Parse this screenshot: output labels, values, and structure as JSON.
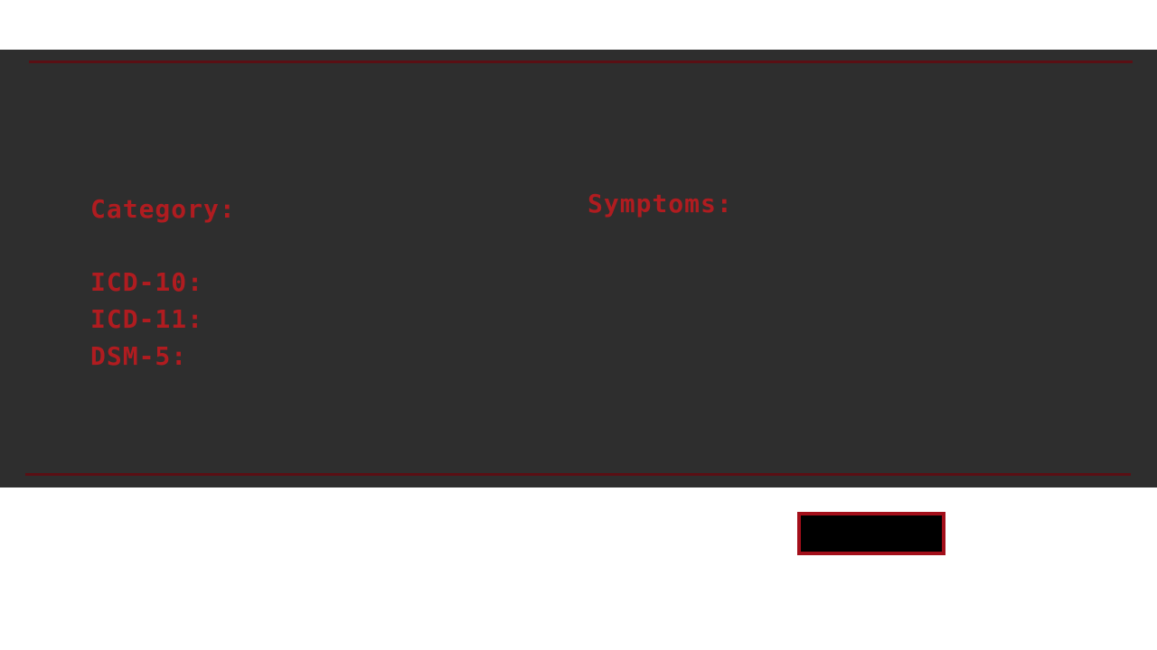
{
  "record": {
    "category_label": "Category:",
    "codes": [
      {
        "label": "ICD-10:"
      },
      {
        "label": "ICD-11:"
      },
      {
        "label": "DSM-5:"
      }
    ],
    "symptoms_label": "Symptoms:"
  },
  "action_button": {
    "label": ""
  },
  "colors": {
    "panel_background": "#2e2e2e",
    "label_text": "#b01c20",
    "rule": "#5a0f14",
    "button_fill": "#000000",
    "button_border": "#a30f1a"
  }
}
